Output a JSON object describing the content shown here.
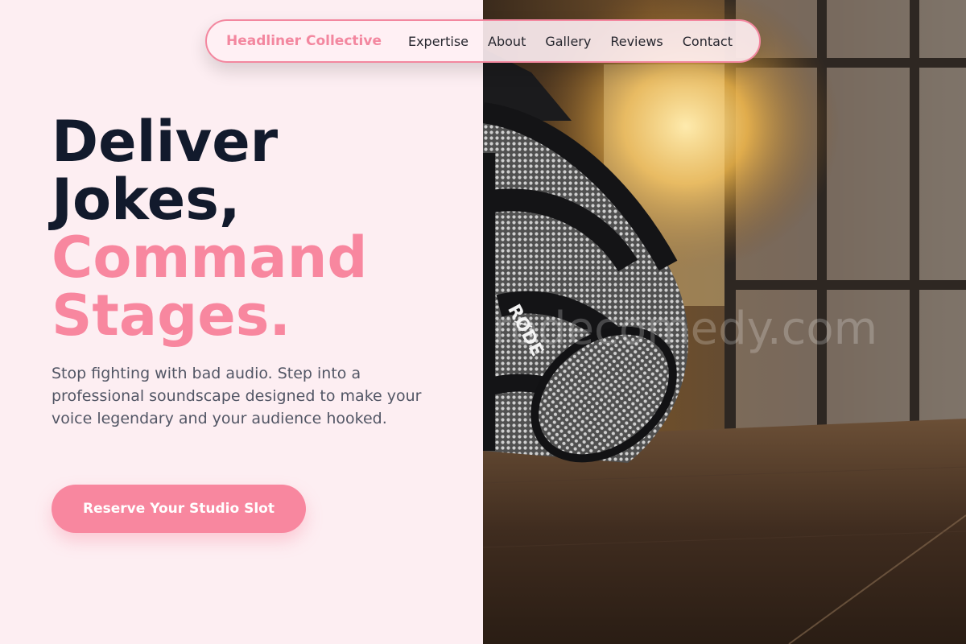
{
  "nav": {
    "brand": "Headliner Collective",
    "links": [
      {
        "label": "Expertise"
      },
      {
        "label": "About"
      },
      {
        "label": "Gallery"
      },
      {
        "label": "Reviews"
      },
      {
        "label": "Contact"
      }
    ]
  },
  "hero": {
    "headline_line1": "Deliver",
    "headline_line2": "Jokes,",
    "headline_line3": "Command",
    "headline_line4": "Stages.",
    "subtext": "Stop fighting with bad audio. Step into a professional soundscape designed to make your voice legendary and your audience hooked.",
    "cta_label": "Reserve Your Studio Slot"
  },
  "image": {
    "mic_brand": "RØDE",
    "watermark": "rodecomedy.com"
  },
  "colors": {
    "accent": "#f8879f",
    "heading_dark": "#121a2c",
    "background": "#fdeef2"
  }
}
